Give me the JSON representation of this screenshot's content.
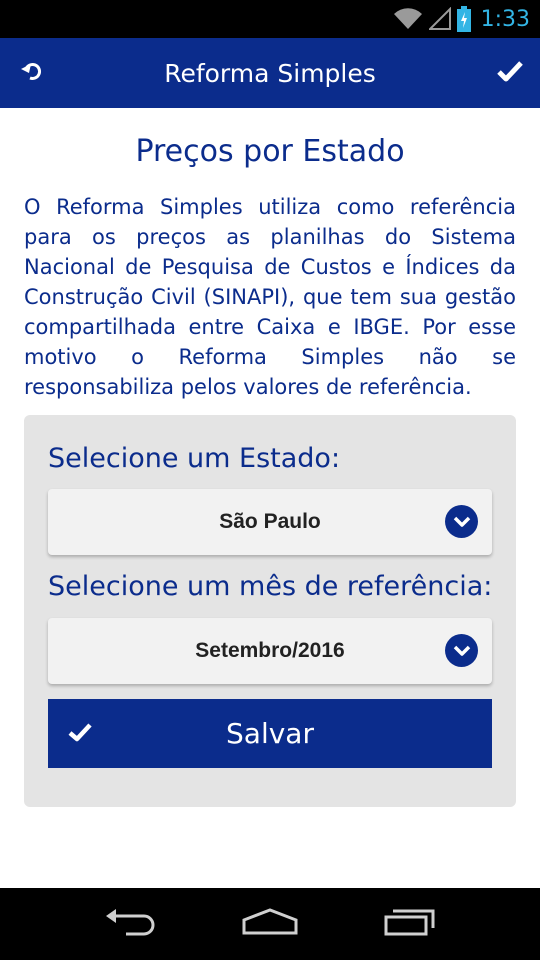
{
  "status_bar": {
    "time": "1:33"
  },
  "app_bar": {
    "title": "Reforma Simples"
  },
  "page": {
    "heading": "Preços por Estado",
    "intro": "O Reforma Simples utiliza como referência para os preços as planilhas do Sistema Nacional de Pesquisa de Custos e Índices da Construção Civil (SINAPI), que tem sua gestão compartilhada entre Caixa e IBGE. Por esse motivo o Reforma Simples não se responsabiliza pelos valores de referência."
  },
  "form": {
    "state_label": "Selecione um Estado:",
    "state_value": "São Paulo",
    "month_label": "Selecione um mês de referência:",
    "month_value": "Setembro/2016",
    "save_label": "Salvar"
  },
  "colors": {
    "primary": "#0b2c8c",
    "card_bg": "#e4e4e4",
    "status_accent": "#33b5e5"
  },
  "icons": [
    "wifi-icon",
    "signal-icon",
    "battery-icon",
    "back-icon",
    "check-icon",
    "chevron-down-icon",
    "nav-back-icon",
    "nav-home-icon",
    "nav-recents-icon"
  ]
}
